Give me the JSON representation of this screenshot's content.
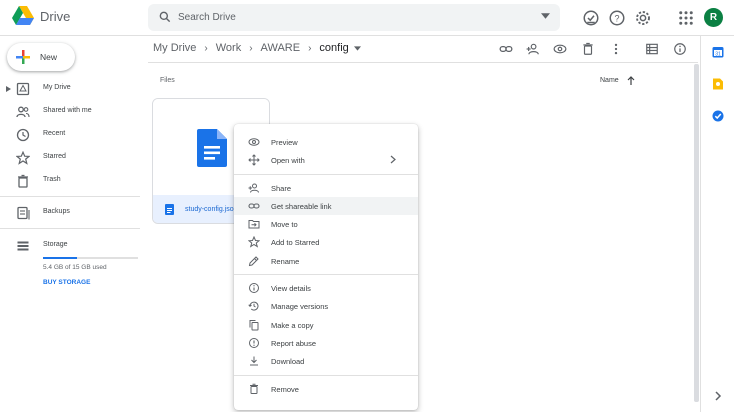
{
  "app": {
    "name": "Drive"
  },
  "search": {
    "placeholder": "Search Drive"
  },
  "user": {
    "initial": "R"
  },
  "sidebar": {
    "new_label": "New",
    "items": [
      {
        "label": "My Drive",
        "icon": "my-drive-icon"
      },
      {
        "label": "Shared with me",
        "icon": "shared-icon"
      },
      {
        "label": "Recent",
        "icon": "clock-icon"
      },
      {
        "label": "Starred",
        "icon": "star-icon"
      },
      {
        "label": "Trash",
        "icon": "trash-icon"
      },
      {
        "label": "Backups",
        "icon": "backup-icon"
      },
      {
        "label": "Storage",
        "icon": "storage-icon"
      }
    ],
    "storage_used": "5.4 GB of 15 GB used",
    "storage_fraction": 0.36,
    "buy_storage": "BUY STORAGE"
  },
  "breadcrumb": [
    "My Drive",
    "Work",
    "AWARE",
    "config"
  ],
  "main": {
    "section_label": "Files",
    "sort_label": "Name",
    "file": {
      "name": "study-config.json"
    }
  },
  "context_menu": {
    "groups": [
      [
        {
          "label": "Preview",
          "icon": "eye-icon"
        },
        {
          "label": "Open with",
          "icon": "move-arrows-icon",
          "submenu": true
        }
      ],
      [
        {
          "label": "Share",
          "icon": "add-person-icon"
        },
        {
          "label": "Get shareable link",
          "icon": "link-icon",
          "hover": true
        },
        {
          "label": "Move to",
          "icon": "folder-move-icon"
        },
        {
          "label": "Add to Starred",
          "icon": "star-icon"
        },
        {
          "label": "Rename",
          "icon": "pencil-icon"
        }
      ],
      [
        {
          "label": "View details",
          "icon": "info-icon"
        },
        {
          "label": "Manage versions",
          "icon": "history-icon"
        },
        {
          "label": "Make a copy",
          "icon": "copy-icon"
        },
        {
          "label": "Report abuse",
          "icon": "alert-icon"
        },
        {
          "label": "Download",
          "icon": "download-icon"
        }
      ],
      [
        {
          "label": "Remove",
          "icon": "trash-icon"
        }
      ]
    ]
  },
  "colors": {
    "accent": "#1a73e8",
    "file_bg": "#e8f0fe",
    "doc_blue": "#1a73e8"
  }
}
